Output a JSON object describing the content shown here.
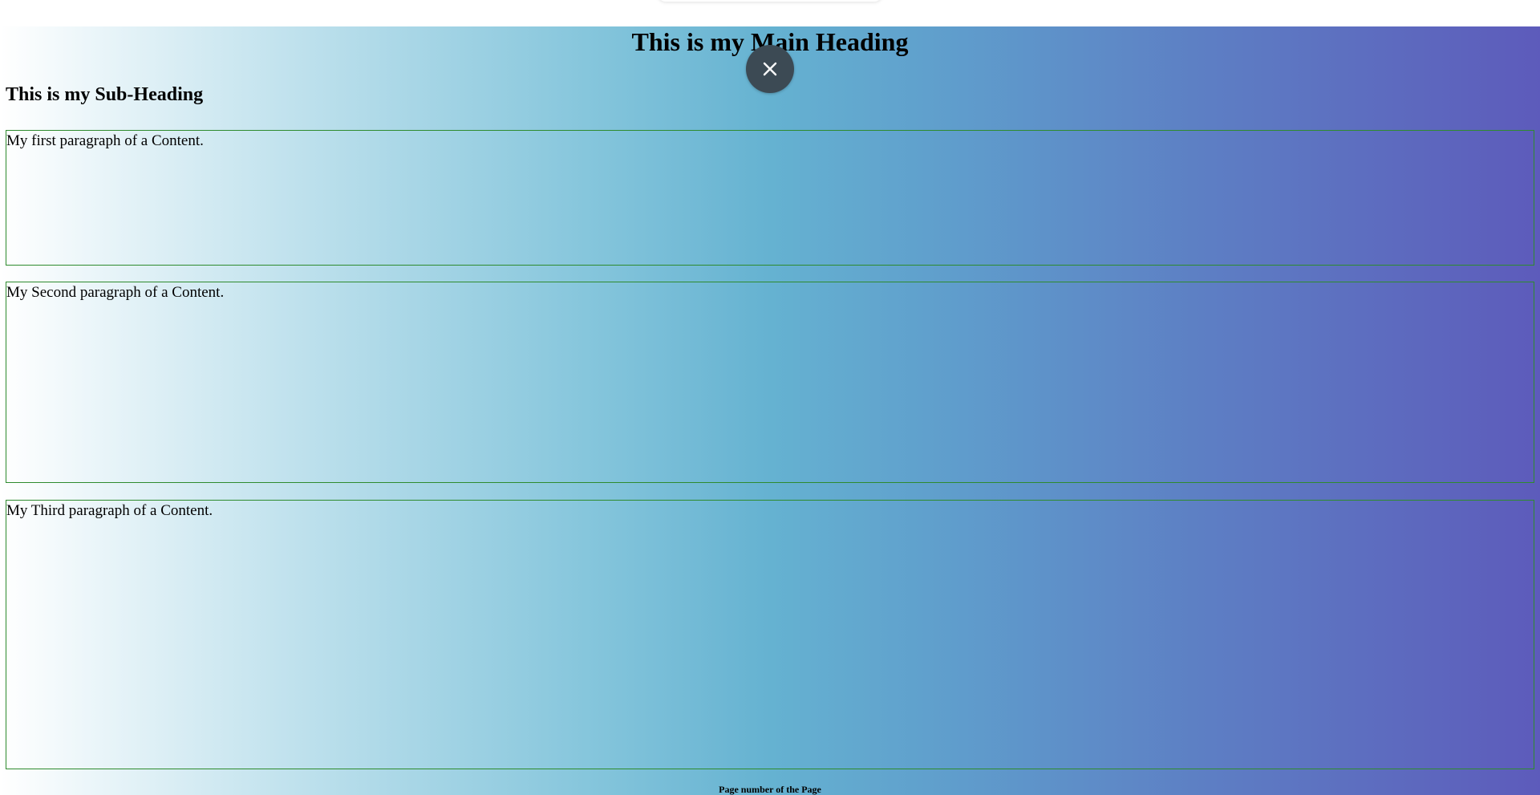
{
  "header": {
    "main_heading": "This is my Main Heading",
    "sub_heading": "This is my Sub-Heading"
  },
  "content": {
    "paragraphs": [
      "My first paragraph of a Content.",
      "My Second paragraph of a Content.",
      "My Third paragraph of a Content."
    ]
  },
  "footer": {
    "text": "Page number of the Page"
  },
  "overlay": {
    "close_icon": "close-icon"
  },
  "colors": {
    "gradient_start": "#ffffff",
    "gradient_mid": "#65b2d1",
    "gradient_end": "#5d5bbb",
    "box_border": "#2e8b2e",
    "close_button_bg": "#3c4a54"
  }
}
